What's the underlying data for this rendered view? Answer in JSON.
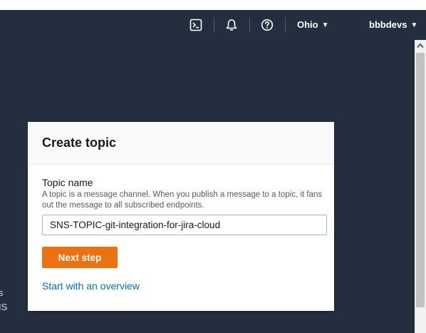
{
  "nav": {
    "icons": [
      "cloudshell-icon",
      "bell-icon",
      "help-icon"
    ],
    "region_label": "Ohio",
    "account_label": "bbbdevs",
    "caret": "▼"
  },
  "background_text": {
    "line1": "s",
    "line2": "IS"
  },
  "card": {
    "title": "Create topic",
    "field_label": "Topic name",
    "field_description": "A topic is a message channel. When you publish a message to a topic, it fans out the message to all subscribed endpoints.",
    "input_value": "SNS-TOPIC-git-integration-for-jira-cloud",
    "next_button": "Next step",
    "overview_link": "Start with an overview"
  },
  "colors": {
    "navbar_bg": "#232f3e",
    "primary_button": "#ec7211",
    "link": "#0073bb"
  }
}
